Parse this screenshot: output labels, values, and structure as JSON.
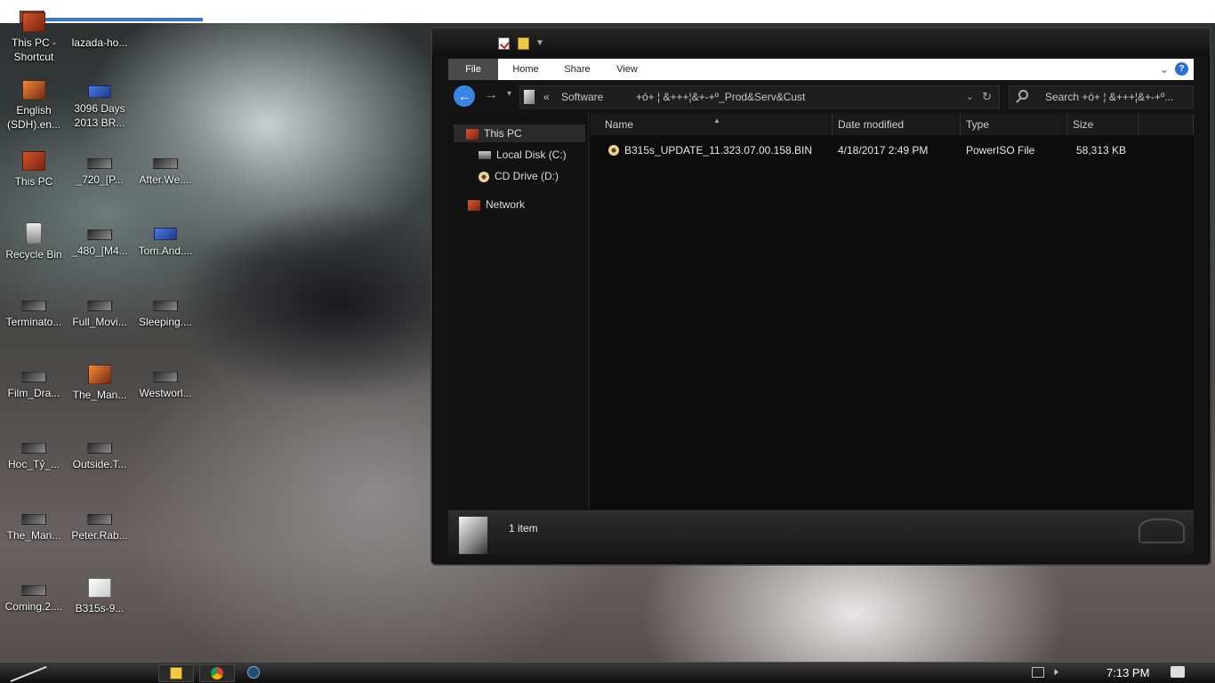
{
  "desktop": {
    "icons": [
      {
        "label": "This PC -\nShortcut",
        "icon": "this-pc-shortcut-icon"
      },
      {
        "label": "lazada-ho...",
        "icon": "document-icon"
      },
      {
        "label": "English\n(SDH).en...",
        "icon": "subtitle-file-icon"
      },
      {
        "label": "3096 Days\n2013 BR...",
        "icon": "video-thumbnail-icon"
      },
      {
        "label": "This PC",
        "icon": "this-pc-icon"
      },
      {
        "label": "_720_[P...",
        "icon": "video-thumbnail-icon"
      },
      {
        "label": "After.We....",
        "icon": "video-thumbnail-icon"
      },
      {
        "label": "Recycle Bin",
        "icon": "recycle-bin-icon"
      },
      {
        "label": "_480_[M4...",
        "icon": "video-thumbnail-icon"
      },
      {
        "label": "Tom.And....",
        "icon": "video-thumbnail-icon"
      },
      {
        "label": "Terminato...",
        "icon": "video-thumbnail-icon"
      },
      {
        "label": "Full_Movi...",
        "icon": "video-thumbnail-icon"
      },
      {
        "label": "Sleeping....",
        "icon": "video-thumbnail-icon"
      },
      {
        "label": "Film_Dra...",
        "icon": "video-thumbnail-icon"
      },
      {
        "label": "The_Man...",
        "icon": "video-thumbnail-icon"
      },
      {
        "label": "Westworl...",
        "icon": "video-thumbnail-icon"
      },
      {
        "label": "Hoc_Tỷ_...",
        "icon": "video-thumbnail-icon"
      },
      {
        "label": "Outside.T...",
        "icon": "video-thumbnail-icon"
      },
      {
        "label": "The_Man...",
        "icon": "video-thumbnail-icon"
      },
      {
        "label": "Peter.Rab...",
        "icon": "video-thumbnail-icon"
      },
      {
        "label": "Coming.2....",
        "icon": "video-thumbnail-icon"
      },
      {
        "label": "B315s-9...",
        "icon": "file-icon"
      }
    ]
  },
  "explorer": {
    "ribbon": {
      "tabs": [
        "File",
        "Home",
        "Share",
        "View"
      ],
      "help": "?"
    },
    "navigation": {
      "back": "←",
      "forward": "→",
      "recent": "⌄",
      "separator": "«",
      "breadcrumbs": [
        "Software",
        "+ó+ ¦ &+++¦&+-+º_Prod&Serv&Cust"
      ],
      "search_placeholder": "Search +ó+ ¦ &+++¦&+-+º..."
    },
    "nav_pane": {
      "items": [
        "This PC",
        "Local Disk (C:)",
        "CD Drive (D:)",
        "Network"
      ]
    },
    "columns": [
      "Name",
      "Date modified",
      "Type",
      "Size"
    ],
    "files": [
      {
        "name": "B315s_UPDATE_11.323.07.00.158.BIN",
        "date": "4/18/2017 2:49 PM",
        "type": "PowerISO File",
        "size": "58,313 KB"
      }
    ],
    "status": "1 item"
  },
  "taskbar": {
    "apps": [
      "File Explorer",
      "Google Chrome",
      "Steam"
    ],
    "clock": "7:13 PM"
  }
}
